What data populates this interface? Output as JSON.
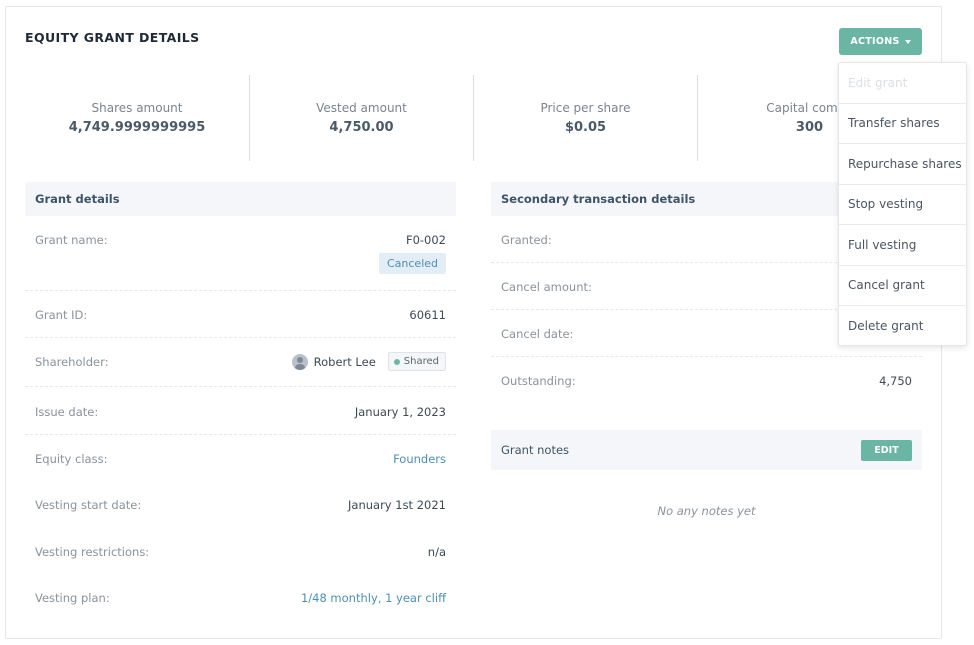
{
  "page": {
    "title": "EQUITY GRANT DETAILS",
    "actions_label": "ACTIONS"
  },
  "stats": [
    {
      "label": "Shares amount",
      "value": "4,749.9999999995"
    },
    {
      "label": "Vested amount",
      "value": "4,750.00"
    },
    {
      "label": "Price per share",
      "value": "$0.05"
    },
    {
      "label": "Capital commi",
      "value": "300"
    }
  ],
  "grant_details": {
    "header": "Grant details",
    "grant_name": {
      "label": "Grant name:",
      "value": "F0-002",
      "status": "Canceled"
    },
    "grant_id": {
      "label": "Grant ID:",
      "value": "60611"
    },
    "shareholder": {
      "label": "Shareholder:",
      "name": "Robert Lee",
      "badge": "Shared"
    },
    "issue_date": {
      "label": "Issue date:",
      "value": "January 1, 2023"
    },
    "equity_class": {
      "label": "Equity class:",
      "value": "Founders"
    },
    "vesting_start": {
      "label": "Vesting start date:",
      "value": "January 1st 2021"
    },
    "vesting_restrictions": {
      "label": "Vesting restrictions:",
      "value": "n/a"
    },
    "vesting_plan": {
      "label": "Vesting plan:",
      "value": "1/48 monthly, 1 year cliff"
    }
  },
  "secondary": {
    "header": "Secondary transaction details",
    "granted": {
      "label": "Granted:",
      "value": ""
    },
    "cancel_amount": {
      "label": "Cancel amount:",
      "value": ""
    },
    "cancel_date": {
      "label": "Cancel date:",
      "value": ""
    },
    "outstanding": {
      "label": "Outstanding:",
      "value": "4,750"
    }
  },
  "notes": {
    "header": "Grant notes",
    "edit_label": "EDIT",
    "empty": "No any notes yet"
  },
  "actions_menu": [
    {
      "label": "Edit grant",
      "disabled": true
    },
    {
      "label": "Transfer shares"
    },
    {
      "label": "Repurchase shares"
    },
    {
      "label": "Stop vesting"
    },
    {
      "label": "Full vesting"
    },
    {
      "label": "Cancel grant"
    },
    {
      "label": "Delete grant"
    }
  ],
  "colors": {
    "accent": "#6bb5a5",
    "link": "#4f8fb0"
  }
}
